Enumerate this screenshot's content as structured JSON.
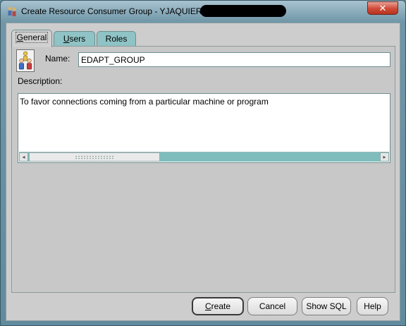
{
  "window": {
    "title": "Create Resource Consumer Group - YJAQUIER@",
    "close_label": "✕"
  },
  "tabs": [
    {
      "label_mnemonic": "G",
      "label_rest": "eneral",
      "active": true
    },
    {
      "label_mnemonic": "U",
      "label_rest": "sers",
      "active": false
    },
    {
      "label_mnemonic": "R",
      "label_rest": "oles",
      "active": false
    }
  ],
  "form": {
    "name_label": "Name:",
    "name_value": "EDAPT_GROUP",
    "description_label": "Description:",
    "description_value": "To favor connections coming from a particular machine or program"
  },
  "scrollbar": {
    "left_arrow": "◂",
    "right_arrow": "▸"
  },
  "buttons": {
    "create_mnemonic": "C",
    "create_rest": "reate",
    "cancel": "Cancel",
    "show_sql": "Show SQL",
    "help": "Help"
  }
}
